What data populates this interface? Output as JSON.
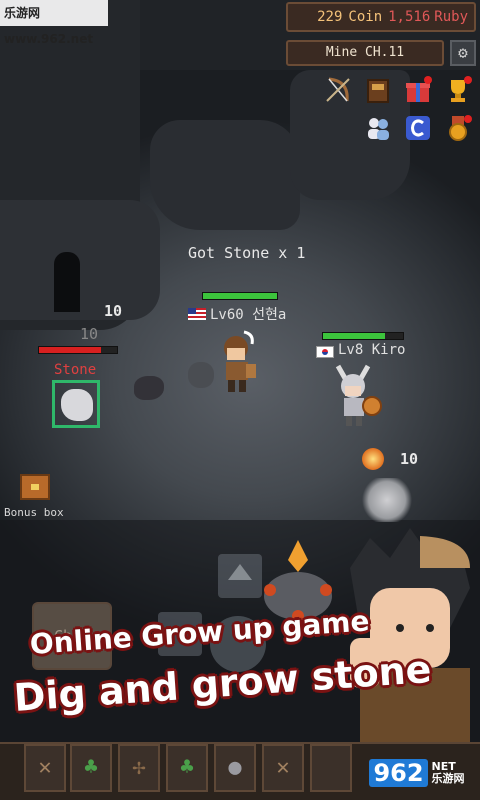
{
  "watermark_top": "乐游网 www.962.net",
  "currency": {
    "coin_value": "229",
    "coin_label": "Coin",
    "ruby_value": "1,516",
    "ruby_label": "Ruby"
  },
  "mine_label": "Mine CH.11",
  "icons": {
    "settings": "gear-icon",
    "row1": [
      "bow-icon",
      "spellbook-icon",
      "gift-box-icon",
      "trophy-icon"
    ],
    "row2": [
      "friends-icon",
      "c-coin-icon",
      "medal-icon"
    ]
  },
  "floating_texts": {
    "got_stone": "Got Stone x 1",
    "damage_1": "10",
    "damage_2": "10",
    "damage_3": "10"
  },
  "players": [
    {
      "flag": "us-flag-icon",
      "name": "Lv60 선현a",
      "hp_fraction": 1.0,
      "hp_color": "#3cc43c"
    },
    {
      "flag": "kr-flag-icon",
      "name": "Lv8 Kiro",
      "hp_fraction": 0.78,
      "hp_color": "#3cc43c"
    }
  ],
  "target": {
    "name": "Stone",
    "hp_fraction": 0.8,
    "hp_color": "#d82020"
  },
  "bonus_box": {
    "label": "Bonus box"
  },
  "chat_label": "Chat",
  "promo": {
    "line1": "Online Grow up game",
    "line2": "Dig and grow stone"
  },
  "watermark_bottom": {
    "brand": "962",
    "sub": "NET",
    "sub2": "乐游网"
  }
}
